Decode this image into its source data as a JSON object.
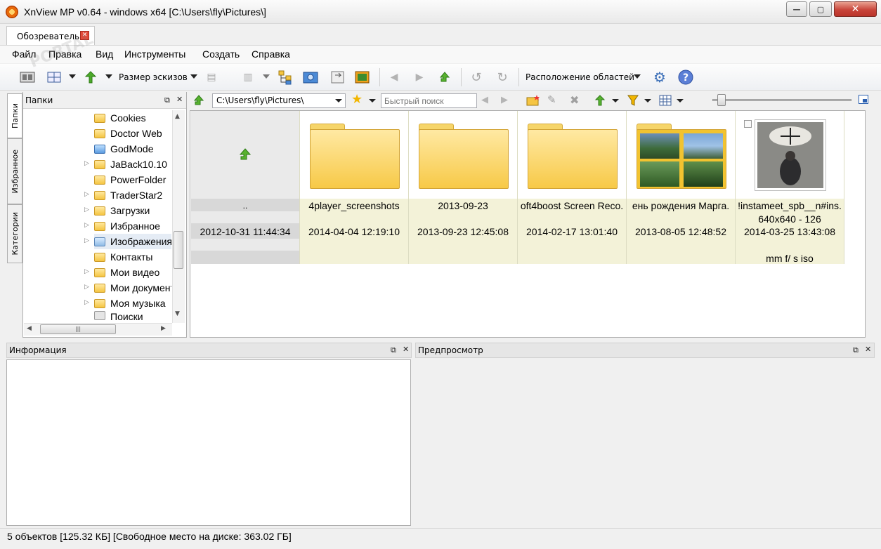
{
  "window": {
    "title": "XnView MP v0.64 - windows x64 [C:\\Users\\fly\\Pictures\\]",
    "min": "—",
    "max": "▢",
    "close": "✕"
  },
  "tabs": [
    {
      "label": "Обозреватель",
      "close": "✕"
    }
  ],
  "menu": [
    "Файл",
    "Правка",
    "Вид",
    "Инструменты",
    "Создать",
    "Справка"
  ],
  "toolbar": {
    "thumb_size_label": "Размер эскизов",
    "layout_label": "Расположение областей"
  },
  "left_panel": {
    "side_tabs": [
      "Папки",
      "Избранное",
      "Категории"
    ],
    "folders_title": "Папки",
    "tree": [
      "Cookies",
      "Doctor Web",
      "GodMode",
      "JaBack10.10",
      "PowerFolder",
      "TraderStar2",
      "Загрузки",
      "Избранное",
      "Изображения",
      "Контакты",
      "Мои видео",
      "Мои документы",
      "Моя музыка",
      "Поиски"
    ]
  },
  "address": {
    "path": "C:\\Users\\fly\\Pictures\\",
    "search_placeholder": "Быстрый поиск"
  },
  "items": [
    {
      "name": "..",
      "date": "2012-10-31 11:44:34"
    },
    {
      "name": "4player_screenshots",
      "date": "2014-04-04 12:19:10"
    },
    {
      "name": "2013-09-23",
      "date": "2013-09-23 12:45:08"
    },
    {
      "name": "oft4boost Screen Reco.",
      "date": "2014-02-17 13:01:40"
    },
    {
      "name": "ень рождения Марга.",
      "date": "2013-08-05 12:48:52"
    },
    {
      "name": "!instameet_spb__n#ins.",
      "dims": "640x640 - 126",
      "date": "2014-03-25 13:43:08",
      "exif": "mm f/ s iso"
    }
  ],
  "info_panel": {
    "title": "Информация"
  },
  "preview_panel": {
    "title": "Предпросмотр"
  },
  "status": "5 объектов [125.32 КБ] [Свободное место на диске: 363.02 ГБ]",
  "watermark": "PORTAL"
}
